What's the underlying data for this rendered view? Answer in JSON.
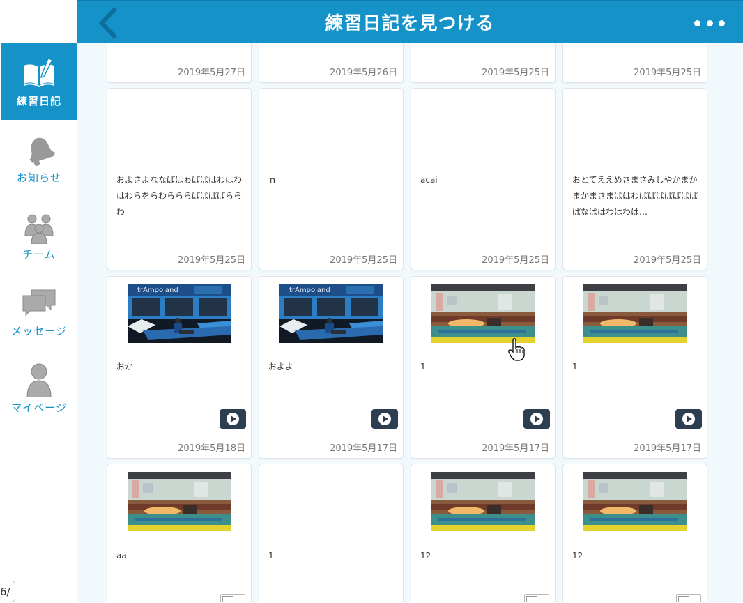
{
  "header": {
    "title": "練習日記を見つける"
  },
  "sidebar": {
    "items": [
      {
        "label": "練習日記",
        "icon": "diary-icon",
        "active": true
      },
      {
        "label": "お知らせ",
        "icon": "bell-icon",
        "active": false
      },
      {
        "label": "チーム",
        "icon": "team-icon",
        "active": false
      },
      {
        "label": "メッセージ",
        "icon": "messages-icon",
        "active": false
      },
      {
        "label": "マイページ",
        "icon": "user-icon",
        "active": false
      }
    ]
  },
  "page_indicator": "6/",
  "cards": [
    {
      "date": "2019年5月27日",
      "text": ""
    },
    {
      "date": "2019年5月26日",
      "text": ""
    },
    {
      "date": "2019年5月25日",
      "text": ""
    },
    {
      "date": "2019年5月25日",
      "text": ""
    },
    {
      "date": "2019年5月25日",
      "text": "およさよななぱはゎぱぱはわはわはわらをらわらららぱぱぱぱららわ"
    },
    {
      "date": "2019年5月25日",
      "text": "ｎ"
    },
    {
      "date": "2019年5月25日",
      "text": "acai"
    },
    {
      "date": "2019年5月25日",
      "text": "おとてええめさまさみしやかまかまかまさまぱはわぱぱぱぱぱぱぱぱなぱはわはわは…"
    },
    {
      "date": "2019年5月18日",
      "text": "おか",
      "thumb": "trampoline"
    },
    {
      "date": "2019年5月17日",
      "text": "およよ",
      "thumb": "trampoline"
    },
    {
      "date": "2019年5月17日",
      "text": "1",
      "thumb": "gym"
    },
    {
      "date": "2019年5月17日",
      "text": "1",
      "thumb": "gym"
    },
    {
      "date": "",
      "text": "aa",
      "thumb": "gym"
    },
    {
      "date": "",
      "text": "1"
    },
    {
      "date": "",
      "text": "12",
      "thumb": "gym"
    },
    {
      "date": "",
      "text": "12",
      "thumb": "gym"
    }
  ],
  "colors": {
    "primary": "#1592c8",
    "background": "#f2f9fd",
    "play": "#2c3e50"
  }
}
